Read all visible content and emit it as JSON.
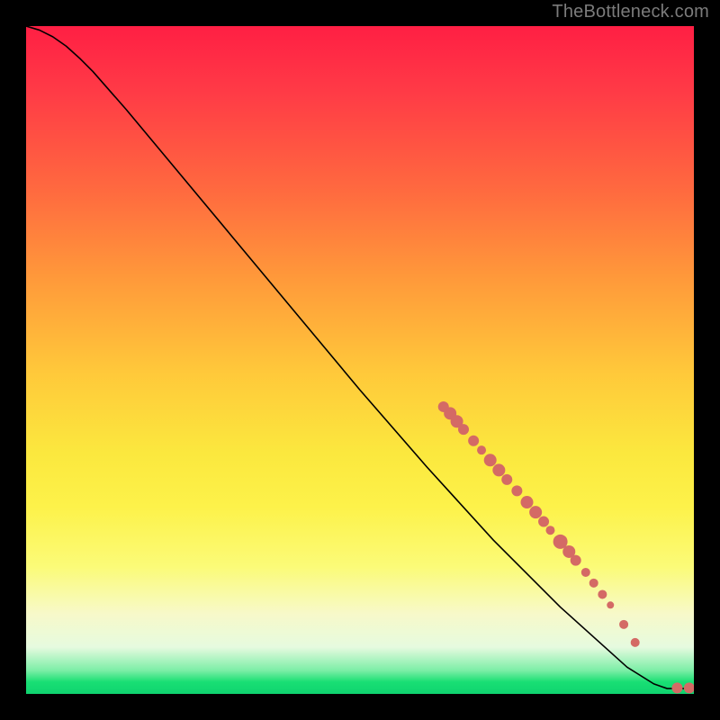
{
  "watermark": "TheBottleneck.com",
  "chart_data": {
    "type": "line",
    "title": "",
    "xlabel": "",
    "ylabel": "",
    "xlim": [
      0,
      100
    ],
    "ylim": [
      0,
      100
    ],
    "grid": false,
    "legend": false,
    "curve": {
      "name": "bottleneck-curve",
      "color": "#000000",
      "points": [
        {
          "x": 0.0,
          "y": 100.0
        },
        {
          "x": 2.0,
          "y": 99.4
        },
        {
          "x": 4.0,
          "y": 98.4
        },
        {
          "x": 6.0,
          "y": 97.0
        },
        {
          "x": 8.0,
          "y": 95.2
        },
        {
          "x": 10.0,
          "y": 93.2
        },
        {
          "x": 15.0,
          "y": 87.5
        },
        {
          "x": 20.0,
          "y": 81.5
        },
        {
          "x": 30.0,
          "y": 69.5
        },
        {
          "x": 40.0,
          "y": 57.5
        },
        {
          "x": 50.0,
          "y": 45.5
        },
        {
          "x": 60.0,
          "y": 34.0
        },
        {
          "x": 70.0,
          "y": 23.0
        },
        {
          "x": 80.0,
          "y": 13.0
        },
        {
          "x": 90.0,
          "y": 4.0
        },
        {
          "x": 94.0,
          "y": 1.5
        },
        {
          "x": 96.0,
          "y": 0.8
        },
        {
          "x": 98.0,
          "y": 0.8
        },
        {
          "x": 100.0,
          "y": 0.8
        }
      ]
    },
    "series": [
      {
        "name": "markers",
        "type": "scatter",
        "color": "#d46a65",
        "points": [
          {
            "x": 62.5,
            "y": 43.0,
            "r": 6
          },
          {
            "x": 63.5,
            "y": 42.0,
            "r": 7
          },
          {
            "x": 64.5,
            "y": 40.8,
            "r": 7
          },
          {
            "x": 65.5,
            "y": 39.6,
            "r": 6
          },
          {
            "x": 67.0,
            "y": 37.9,
            "r": 6
          },
          {
            "x": 68.2,
            "y": 36.5,
            "r": 5
          },
          {
            "x": 69.5,
            "y": 35.0,
            "r": 7
          },
          {
            "x": 70.8,
            "y": 33.5,
            "r": 7
          },
          {
            "x": 72.0,
            "y": 32.1,
            "r": 6
          },
          {
            "x": 73.5,
            "y": 30.4,
            "r": 6
          },
          {
            "x": 75.0,
            "y": 28.7,
            "r": 7
          },
          {
            "x": 76.3,
            "y": 27.2,
            "r": 7
          },
          {
            "x": 77.5,
            "y": 25.8,
            "r": 6
          },
          {
            "x": 78.5,
            "y": 24.5,
            "r": 5
          },
          {
            "x": 80.0,
            "y": 22.8,
            "r": 8
          },
          {
            "x": 81.3,
            "y": 21.3,
            "r": 7
          },
          {
            "x": 82.3,
            "y": 20.0,
            "r": 6
          },
          {
            "x": 83.8,
            "y": 18.2,
            "r": 5
          },
          {
            "x": 85.0,
            "y": 16.6,
            "r": 5
          },
          {
            "x": 86.3,
            "y": 14.9,
            "r": 5
          },
          {
            "x": 87.5,
            "y": 13.3,
            "r": 4
          },
          {
            "x": 89.5,
            "y": 10.4,
            "r": 5
          },
          {
            "x": 91.2,
            "y": 7.7,
            "r": 5
          },
          {
            "x": 97.5,
            "y": 0.9,
            "r": 6
          },
          {
            "x": 99.3,
            "y": 0.9,
            "r": 6
          }
        ]
      }
    ],
    "background_gradient": {
      "top": "#ff1f44",
      "mid": "#fde23f",
      "bottom": "#0fd36f"
    }
  }
}
